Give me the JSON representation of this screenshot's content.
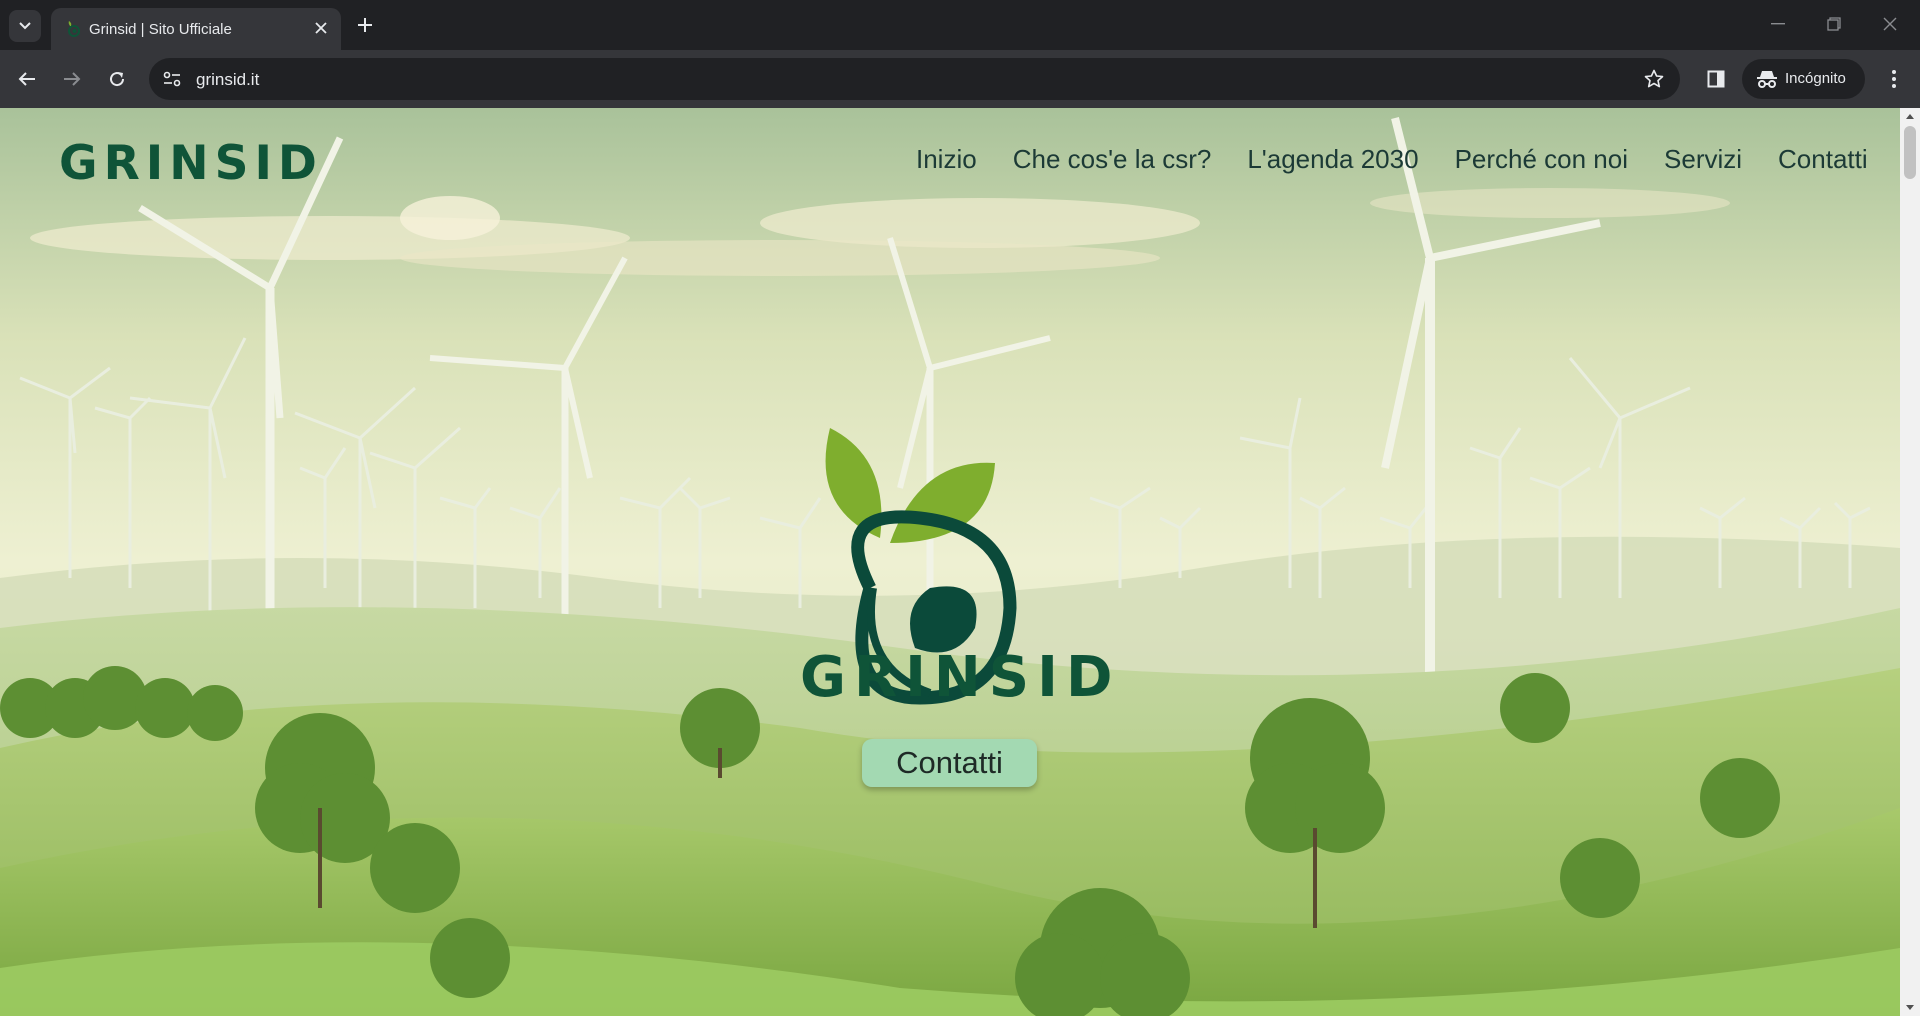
{
  "browser": {
    "tab_title": "Grinsid | Sito Ufficiale",
    "url": "grinsid.it",
    "incognito_label": "Incógnito"
  },
  "site": {
    "brand": "GRINSID",
    "nav": [
      "Inizio",
      "Che cos'e la csr?",
      "L'agenda 2030",
      "Perché con noi",
      "Servizi",
      "Contatti"
    ],
    "hero_brand": "GRINSID",
    "cta_label": "Contatti"
  },
  "colors": {
    "brand_green": "#0f5438",
    "leaf_green": "#7fae2e",
    "cta_bg": "#a3d9b2",
    "chrome_dark": "#202124",
    "chrome_mid": "#35363a"
  },
  "icons": [
    "tab-search-icon",
    "favicon-icon",
    "close-tab-icon",
    "new-tab-icon",
    "minimize-icon",
    "restore-icon",
    "close-window-icon",
    "back-icon",
    "forward-icon",
    "reload-icon",
    "site-info-icon",
    "bookmark-star-icon",
    "side-panel-icon",
    "incognito-icon",
    "menu-icon"
  ]
}
